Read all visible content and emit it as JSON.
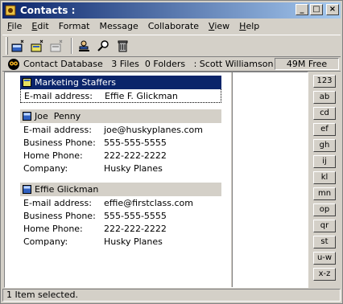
{
  "window": {
    "title": "Contacts :"
  },
  "menu": {
    "items": [
      {
        "first": "F",
        "rest": "ile"
      },
      {
        "first": "E",
        "rest": "dit"
      },
      {
        "first": "",
        "rest": "Format"
      },
      {
        "first": "",
        "rest": "Message"
      },
      {
        "first": "",
        "rest": "Collaborate"
      },
      {
        "first": "V",
        "rest": "iew"
      },
      {
        "first": "H",
        "rest": "elp"
      }
    ]
  },
  "toolbar": {
    "icons": [
      "new-contact-icon",
      "new-list-icon",
      "open-contact-icon",
      "address-icon",
      "find-icon",
      "delete-icon"
    ]
  },
  "path": {
    "text": "Contact Database   3 Files  0 Folders   : Scott Williamson",
    "free": "49M Free"
  },
  "cards": [
    {
      "name": "Marketing Staffers",
      "selected": true,
      "rows": [
        {
          "label": "E-mail address:",
          "value": "Effie F. Glickman"
        }
      ]
    },
    {
      "name": "Joe  Penny",
      "selected": false,
      "rows": [
        {
          "label": "E-mail address:",
          "value": "joe@huskyplanes.com"
        },
        {
          "label": "Business Phone:",
          "value": "555-555-5555"
        },
        {
          "label": "Home Phone:",
          "value": "222-222-2222"
        },
        {
          "label": "Company:",
          "value": "Husky Planes"
        }
      ]
    },
    {
      "name": "Effie Glickman",
      "selected": false,
      "rows": [
        {
          "label": "E-mail address:",
          "value": "effie@firstclass.com"
        },
        {
          "label": "Business Phone:",
          "value": "555-555-5555"
        },
        {
          "label": "Home Phone:",
          "value": "222-222-2222"
        },
        {
          "label": "Company:",
          "value": "Husky Planes"
        }
      ]
    }
  ],
  "alphabet": [
    "123",
    "ab",
    "cd",
    "ef",
    "gh",
    "ij",
    "kl",
    "mn",
    "op",
    "qr",
    "st",
    "u-w",
    "x-z"
  ],
  "status": "1 Item selected."
}
